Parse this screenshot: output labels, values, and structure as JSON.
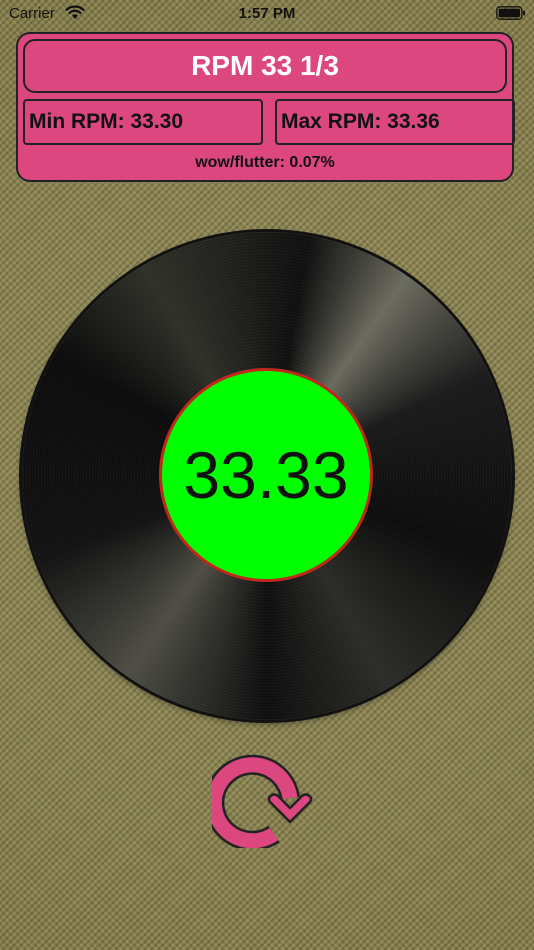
{
  "status_bar": {
    "carrier": "Carrier",
    "time": "1:57 PM",
    "icons": [
      "wifi-icon",
      "battery-icon"
    ]
  },
  "panel": {
    "rpm_mode": "RPM 33 1/3",
    "min_rpm": "Min RPM: 33.30",
    "max_rpm": "Max RPM: 33.36",
    "wow_flutter": "wow/flutter: 0.07%"
  },
  "record": {
    "current_rpm": "33.33",
    "label_color": "#00ff00",
    "label_border_color": "#c0281c"
  },
  "reset": {
    "icon": "reset-rotate-icon",
    "color": "#dd4780"
  },
  "colors": {
    "panel_pink": "#dd4780",
    "background": "#8c844f"
  }
}
